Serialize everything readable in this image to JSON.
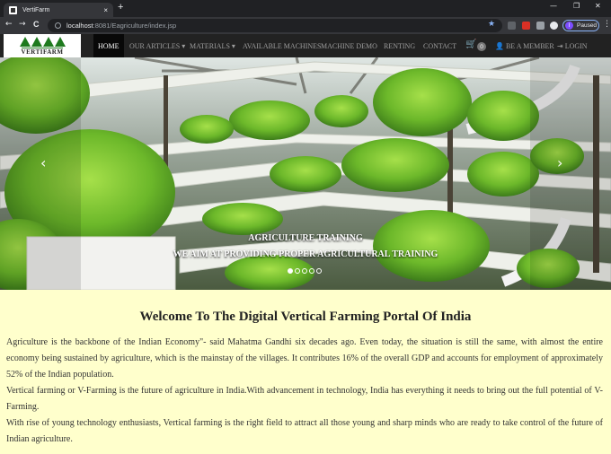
{
  "browser": {
    "tab_title": "VertiFarm",
    "tab_close": "×",
    "new_tab": "+",
    "url_host": "localhost",
    "url_rest": ":8081/Eagriculture/index.jsp",
    "profile_initial": "I",
    "profile_status": "Paused",
    "back": "←",
    "forward": "→",
    "reload": "C",
    "minimize": "—",
    "restore": "❐",
    "close": "✕"
  },
  "nav": {
    "logo_text": "VERTIFARM",
    "items": [
      {
        "label": "HOME"
      },
      {
        "label": "OUR ARTICLES ▾"
      },
      {
        "label": "MATERIALS ▾"
      },
      {
        "label": "AVAILABLE MACHINES"
      },
      {
        "label": "MACHINE DEMO"
      },
      {
        "label": "RENTING"
      },
      {
        "label": "CONTACT"
      }
    ],
    "cart_count": "0",
    "member_label": "BE A MEMBER",
    "login_label": "LOGIN"
  },
  "carousel": {
    "caption_title": "AGRICULTURE TRAINING",
    "caption_text": "WE AIM AT PROVIDING PROPER AGRICULTURAL TRAINING",
    "prev": "‹",
    "next": "›",
    "slide_count": 5,
    "active_slide": 1
  },
  "content": {
    "heading": "Welcome To The Digital Vertical Farming Portal Of India",
    "paragraphs": [
      "Agriculture is the backbone of the Indian Economy\"- said Mahatma Gandhi six decades ago. Even today, the situation is still the same, with almost the entire economy being sustained by agriculture, which is the mainstay of the villages. It contributes 16% of the overall GDP and accounts for employment of approximately 52% of the Indian population.",
      "Vertical farming or V-Farming is the future of agriculture in India.With advancement in technology, India has everything it needs to bring out the full potential of V-Farming.",
      "With rise of young technology enthusiasts, Vertical farming is the right field to attract all those young and sharp minds who are ready to take control of the future of Indian agriculture."
    ]
  },
  "colors": {
    "navbar": "#222222",
    "content_bg": "#ffffcc",
    "accent_green": "#1e7a1e"
  }
}
